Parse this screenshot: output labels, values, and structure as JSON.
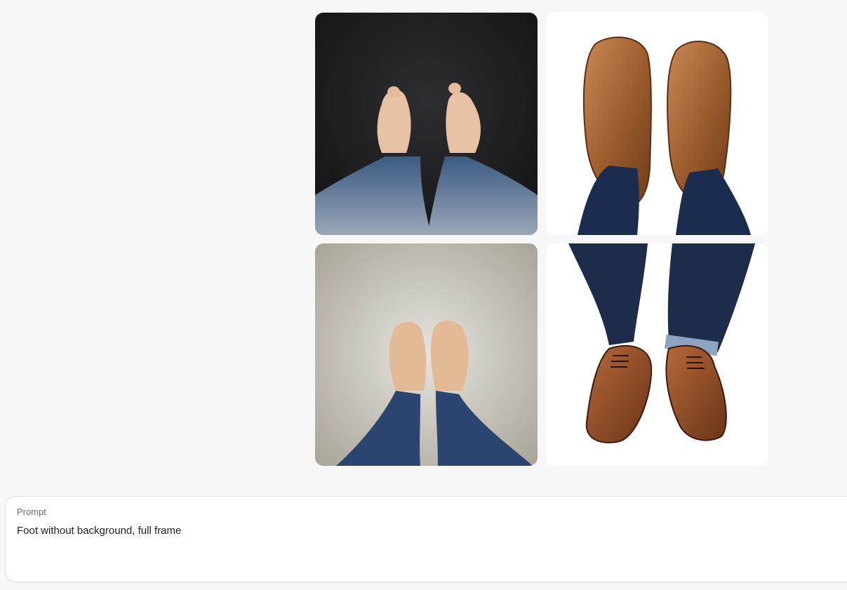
{
  "gallery": {
    "images": [
      {
        "subject": "bare-feet-dark-background"
      },
      {
        "subject": "brown-slip-on-shoes-white-background"
      },
      {
        "subject": "bare-feet-light-background"
      },
      {
        "subject": "brown-oxford-shoes-white-background"
      }
    ]
  },
  "prompt": {
    "label": "Prompt",
    "value": "Foot without background, full frame"
  },
  "colors": {
    "page_background": "#f8f7f7",
    "panel_background": "#ffffff",
    "label_color": "#6e6e6e",
    "text_color": "#1e1e1e"
  }
}
